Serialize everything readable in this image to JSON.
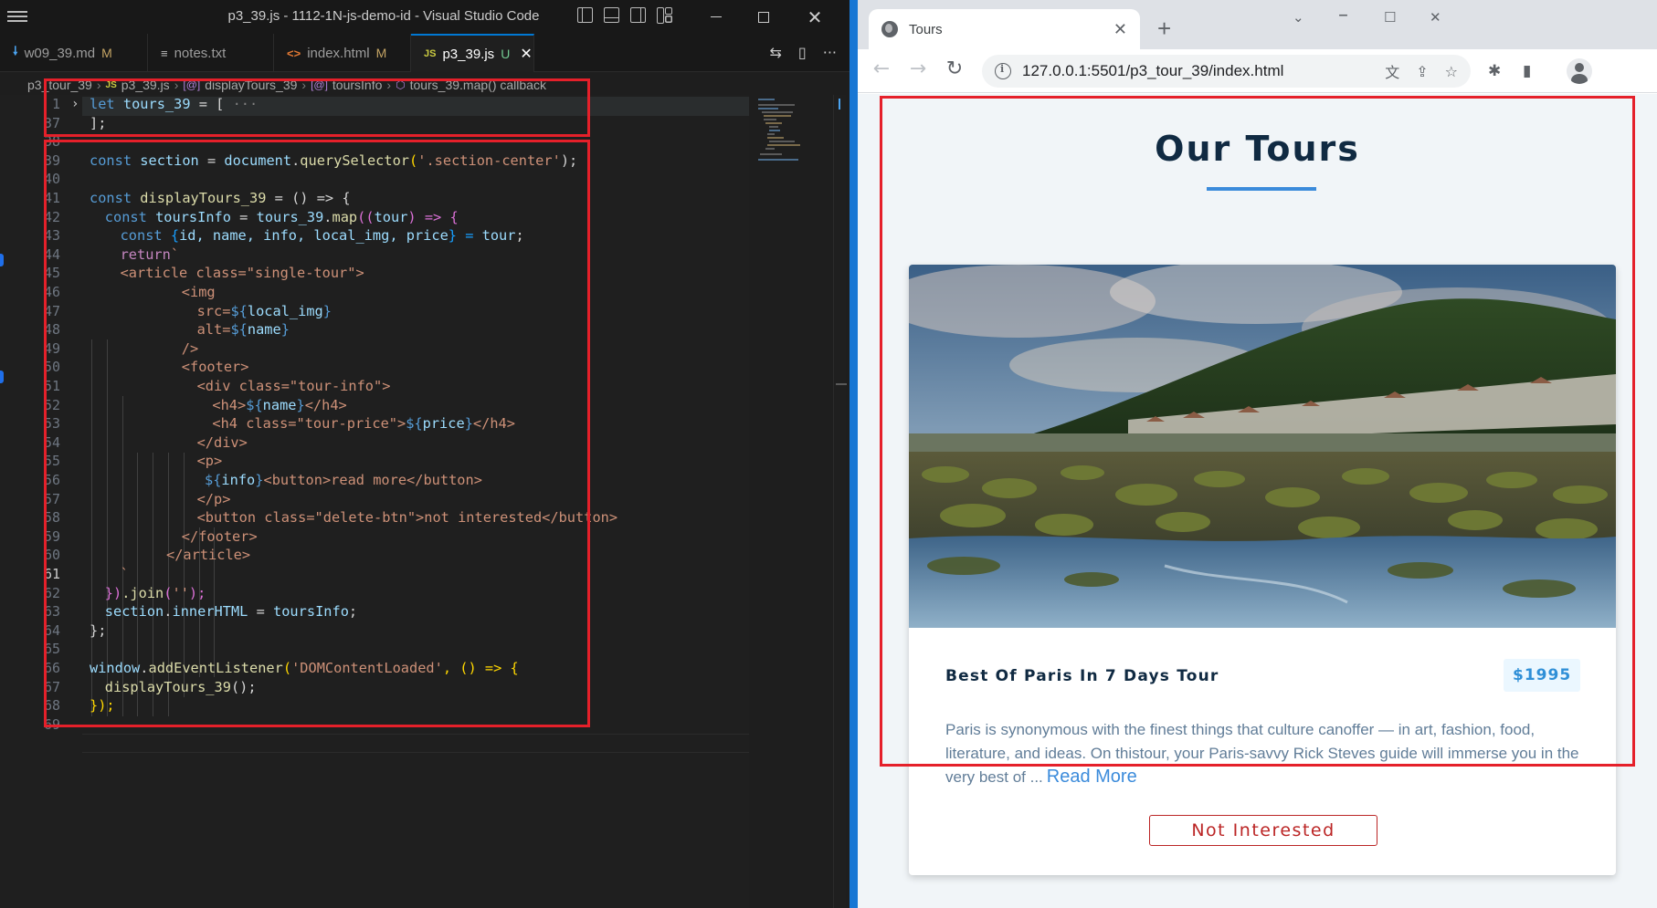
{
  "vscode": {
    "title": "p3_39.js - 1112-1N-js-demo-id - Visual Studio Code",
    "tabs": [
      {
        "label": "w09_39.md",
        "icon": "markdown-icon",
        "status": "M"
      },
      {
        "label": "notes.txt",
        "icon": "text-file-icon",
        "status": ""
      },
      {
        "label": "index.html",
        "icon": "html-icon",
        "status": "M"
      },
      {
        "label": "p3_39.js",
        "icon": "js-icon",
        "status": "U"
      }
    ],
    "tab_icon_text": {
      "md": "🠗",
      "txt": "≡",
      "html": "<>",
      "js": "JS"
    },
    "breadcrumb": [
      {
        "label": "p3_tour_39"
      },
      {
        "label": "p3_39.js",
        "prefix": "JS"
      },
      {
        "label": "displayTours_39",
        "prefix": "[@]"
      },
      {
        "label": "toursInfo",
        "prefix": "[@]"
      },
      {
        "label": "tours_39.map() callback",
        "prefix": "⬡"
      }
    ],
    "line_numbers": [
      "1",
      "37",
      "38",
      "39",
      "40",
      "41",
      "42",
      "43",
      "44",
      "45",
      "46",
      "47",
      "48",
      "49",
      "50",
      "51",
      "52",
      "53",
      "54",
      "55",
      "56",
      "57",
      "58",
      "59",
      "60",
      "61",
      "62",
      "63",
      "64",
      "65",
      "66",
      "67",
      "68",
      "69"
    ],
    "code": {
      "l1_kw": "let",
      "l1_var": "tours_39",
      "l1_rest": " = [",
      "l1_fold": " ···",
      "l37": "];",
      "l39_kw": "const",
      "l39_var": "section",
      "l39_eq": " = ",
      "l39_obj": "document",
      "l39_fn": "querySelector",
      "l39_str": "'.section-center'",
      "l39_end": ");",
      "l41_kw": "const",
      "l41_fn": "displayTours_39",
      "l41_rest": " = () => {",
      "l42_kw": "const",
      "l42_var": "toursInfo",
      "l42_eq": " = ",
      "l42_obj": "tours_39",
      "l42_fn": "map",
      "l42_p": "((",
      "l42_arg": "tour",
      "l42_arrow": ") => {",
      "l43_kw": "const",
      "l43_open": " {",
      "l43_vars": "id, name, info, local_img, price",
      "l43_close": "} = ",
      "l43_tour": "tour",
      "l43_end": ";",
      "l44_kw": "return",
      "l44_tick": "`",
      "l45": "<article class=\"single-tour\">",
      "l46": "<img",
      "l47_a": "src=",
      "l47_d": "${",
      "l47_v": "local_img",
      "l47_c": "}",
      "l48_a": "alt=",
      "l48_d": "${",
      "l48_v": "name",
      "l48_c": "}",
      "l49": "/>",
      "l50": "<footer>",
      "l51": "<div class=\"tour-info\">",
      "l52_a": "<h4>",
      "l52_d": "${",
      "l52_v": "name",
      "l52_c": "}",
      "l52_e": "</h4>",
      "l53_a": "<h4 class=\"tour-price\">",
      "l53_d": "${",
      "l53_v": "price",
      "l53_c": "}",
      "l53_e": "</h4>",
      "l54": "</div>",
      "l55": "<p>",
      "l56_d": "${",
      "l56_v": "info",
      "l56_c": "}",
      "l56_e": "<button>read more</button>",
      "l57": "</p>",
      "l58": "<button class=\"delete-btn\">not interested</button>",
      "l59": "</footer>",
      "l60": "</article>",
      "l61": "`",
      "l62_a": "})",
      "l62_fn": ".join",
      "l62_b": "(",
      "l62_s": "''",
      "l62_e": ");",
      "l63_v": "section",
      "l63_dot": ".",
      "l63_p": "innerHTML",
      "l63_eq": " = ",
      "l63_r": "toursInfo",
      "l63_e": ";",
      "l64": "};",
      "l66_obj": "window",
      "l66_fn": "addEventListener",
      "l66_p": "(",
      "l66_s": "'DOMContentLoaded'",
      "l66_rest": ", () => {",
      "l67_fn": "displayTours_39",
      "l67_e": "();",
      "l68": "});"
    }
  },
  "chrome": {
    "tab_title": "Tours",
    "url": "127.0.0.1:5501/p3_tour_39/index.html",
    "page": {
      "title": "Our Tours",
      "tour": {
        "name": "Best Of Paris In 7 Days Tour",
        "price": "$1995",
        "info": "Paris is synonymous with the finest things that culture canoffer — in art, fashion, food, literature, and ideas. On thistour, your Paris-savvy Rick Steves guide will immerse you in the very best of ...",
        "read_more": "Read More",
        "not_interested": "Not Interested"
      }
    }
  },
  "colors": {
    "accent_blue": "#1877d4",
    "annotation_red": "#e5202a",
    "price_blue": "#2f8fd7",
    "delete_red": "#bb2525"
  }
}
